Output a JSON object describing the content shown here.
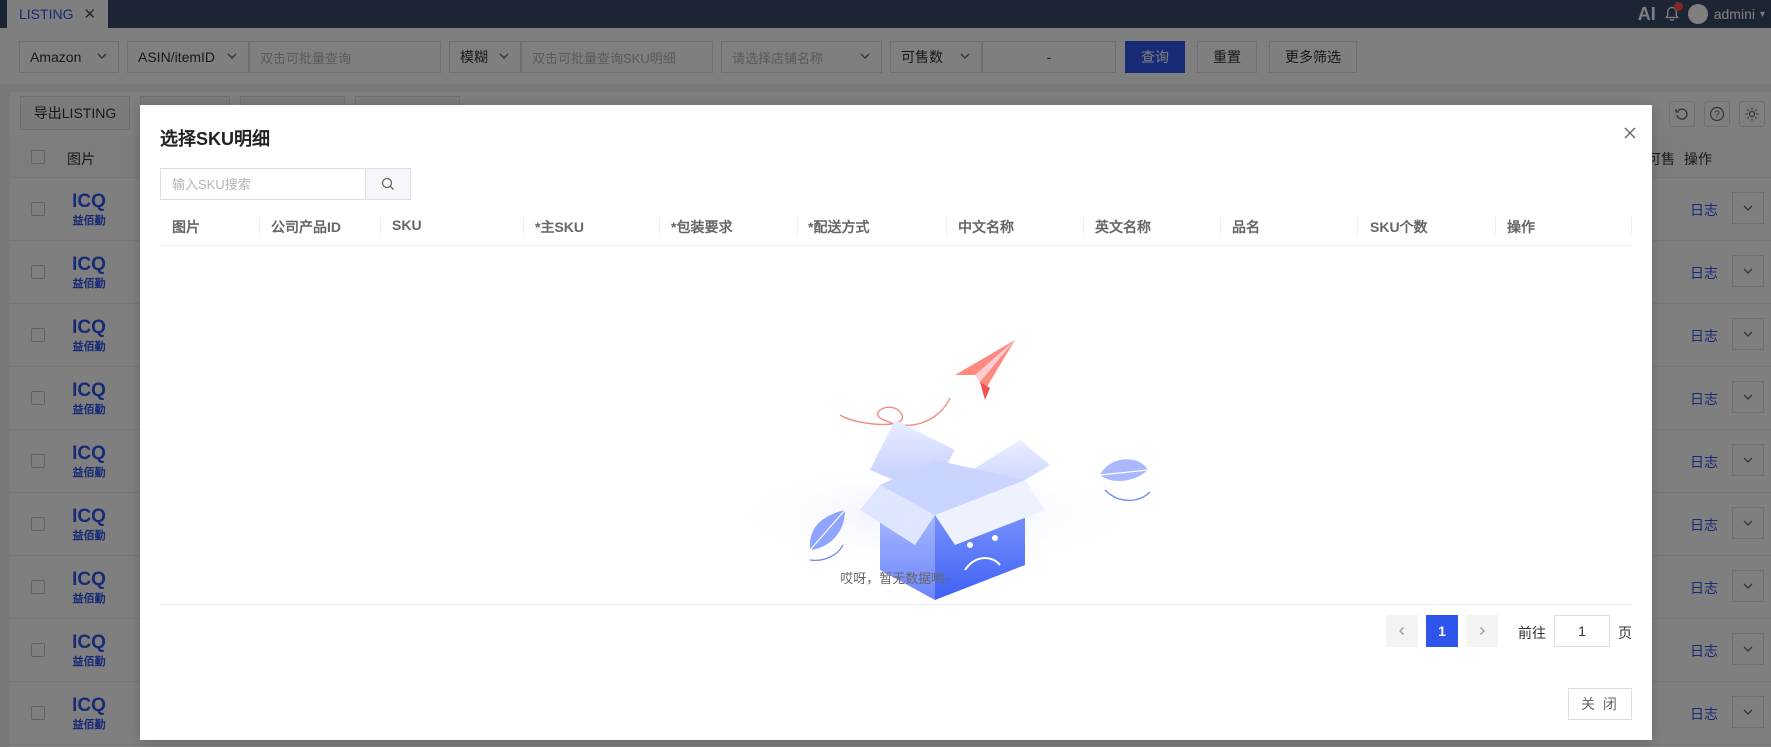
{
  "topbar": {
    "tab_label": "LISTING",
    "tab_close": "✕",
    "ai_label": "AI",
    "username": "admini"
  },
  "filters": {
    "platform": "Amazon",
    "id_type": "ASIN/itemID",
    "id_placeholder": "双击可批量查询",
    "match_mode": "模糊",
    "sku_placeholder": "双击可批量查询SKU明细",
    "store_placeholder": "请选择店铺名称",
    "stock_type": "可售数",
    "range_sep": "-",
    "query_button": "查询",
    "reset_button": "重置",
    "more_button": "更多筛选"
  },
  "toolbar": {
    "export_button": "导出LISTING"
  },
  "bg_table": {
    "col_image": "图片",
    "col_sellable": "可售",
    "col_action": "操作",
    "row_logo_top": "ICQ",
    "row_logo_bottom": "益佰勤",
    "rows": [
      {
        "log": "日志"
      },
      {
        "log": "日志"
      },
      {
        "log": "日志"
      },
      {
        "log": "日志"
      },
      {
        "log": "日志"
      },
      {
        "log": "日志"
      },
      {
        "log": "日志"
      },
      {
        "log": "日志"
      },
      {
        "log": "日志"
      }
    ]
  },
  "modal": {
    "title": "选择SKU明细",
    "search_placeholder": "输入SKU搜索",
    "columns": [
      "图片",
      "公司产品ID",
      "SKU",
      "*主SKU",
      "*包装要求",
      "*配送方式",
      "中文名称",
      "英文名称",
      "品名",
      "SKU个数",
      "操作"
    ],
    "empty_text": "哎呀，暂无数据哟~",
    "pagination": {
      "current_page": "1",
      "goto_label": "前往",
      "goto_value": "1",
      "page_suffix": "页"
    },
    "close_button": "关 闭"
  },
  "colors": {
    "primary": "#2f54eb",
    "topbar": "#3a4a6b"
  }
}
